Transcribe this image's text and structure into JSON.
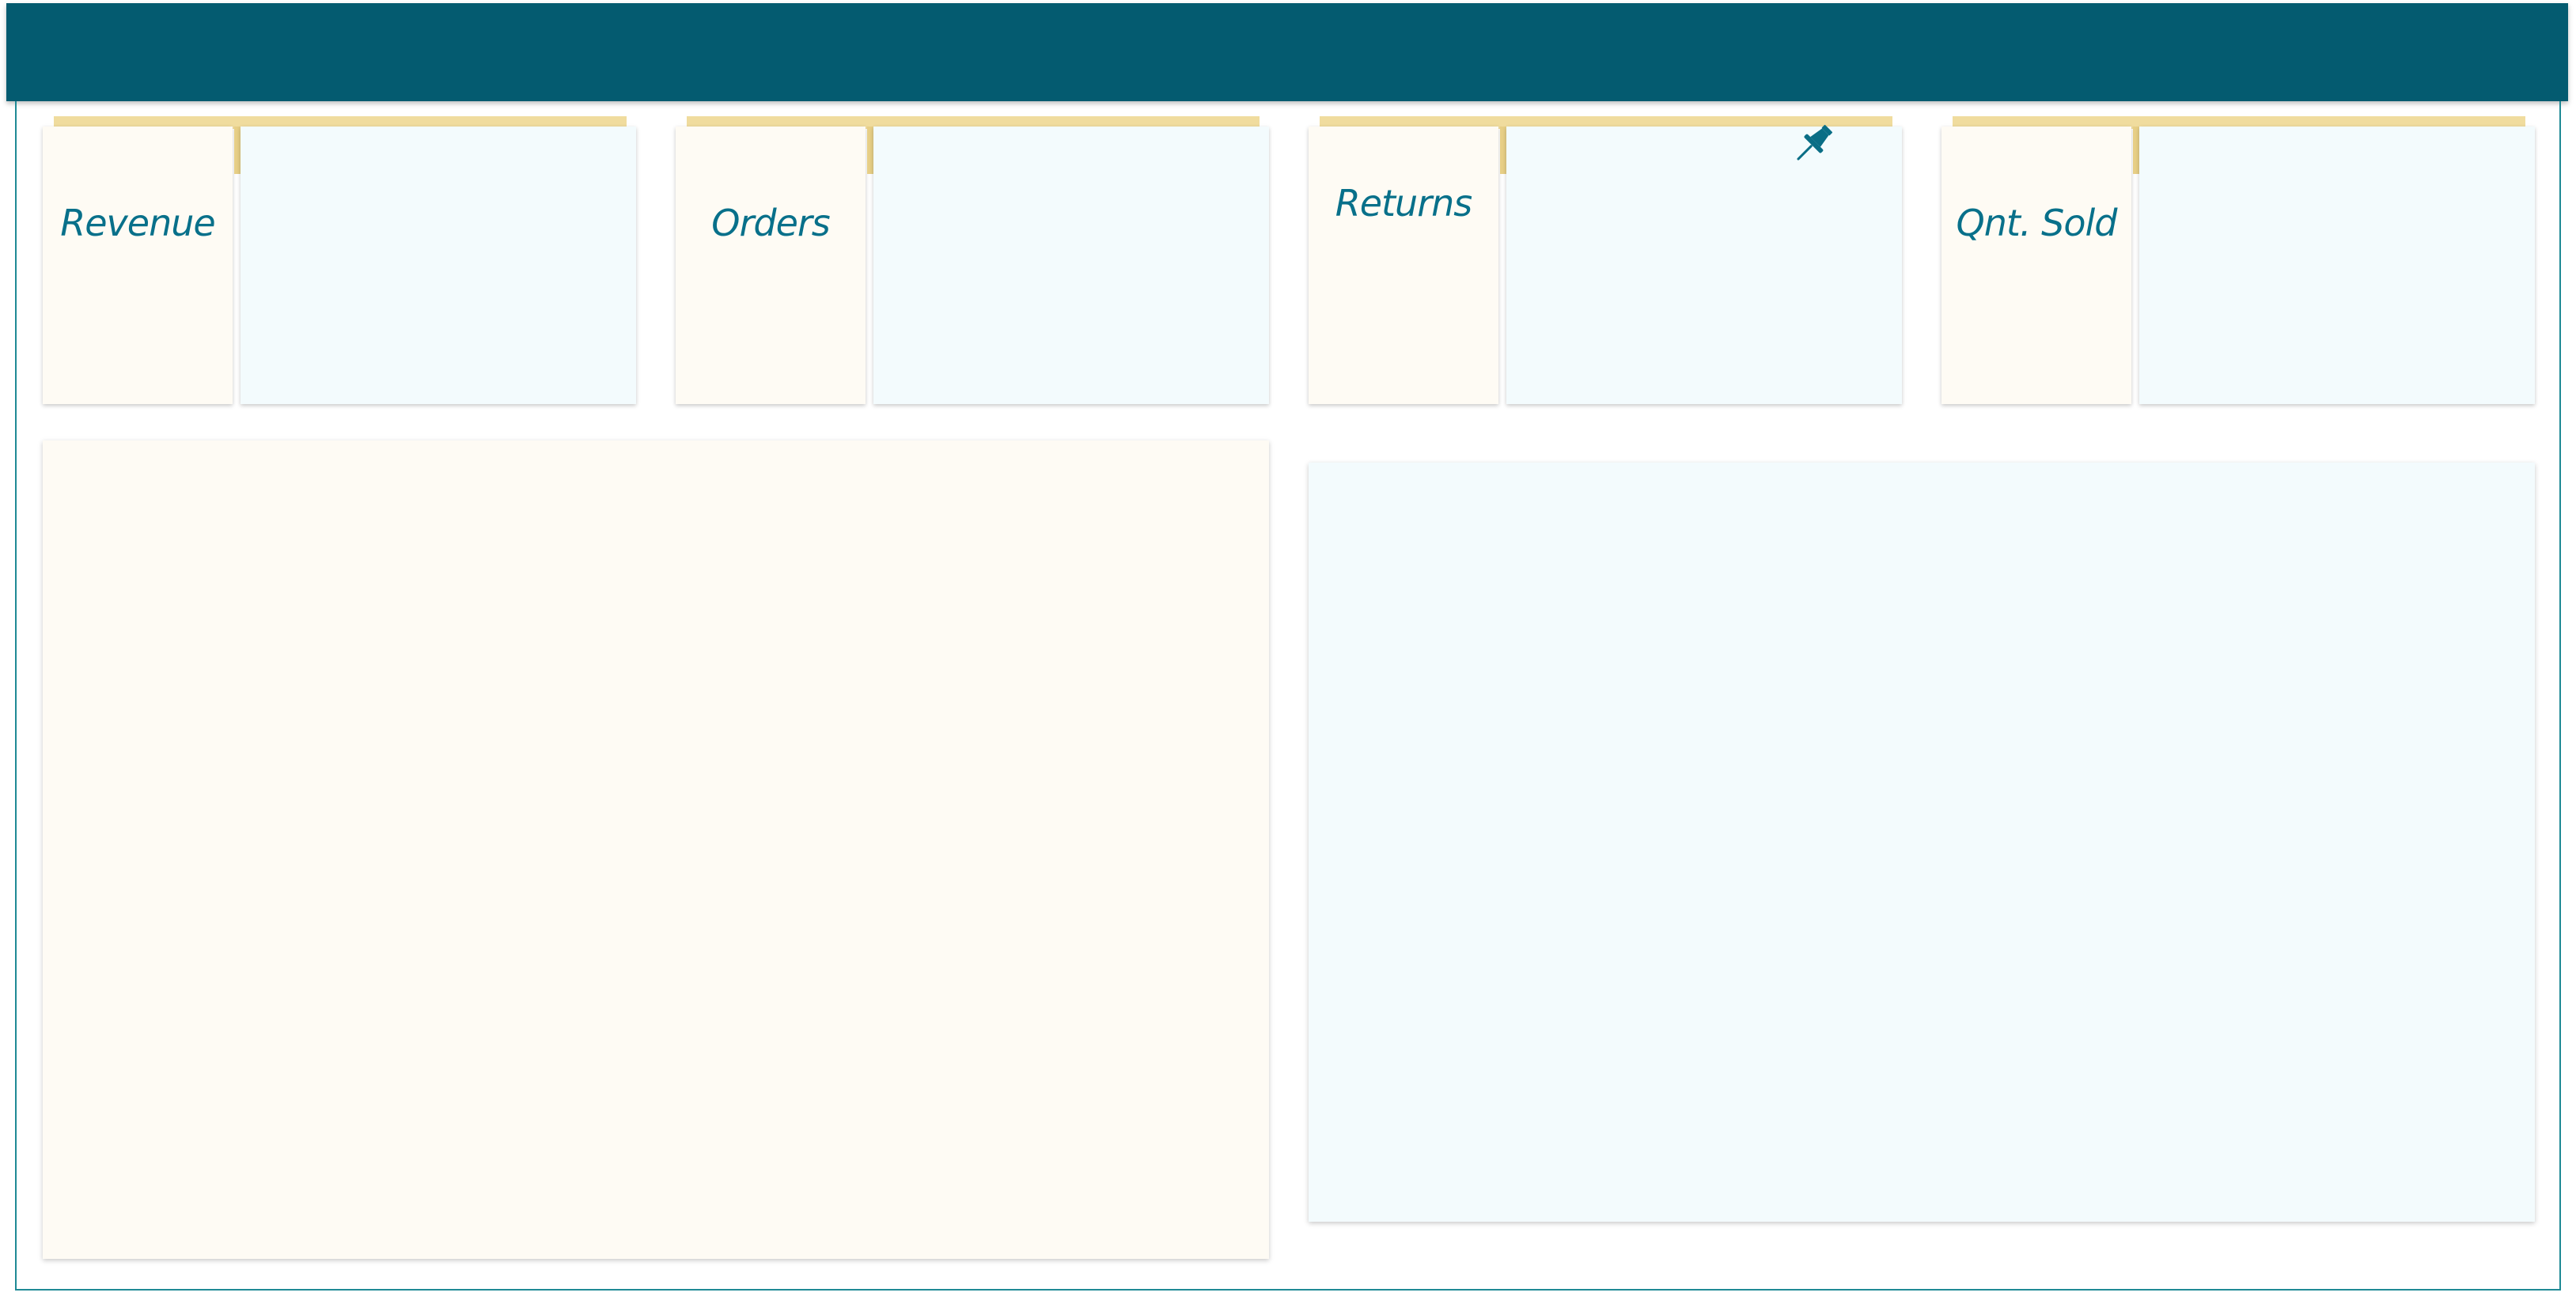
{
  "header": {
    "color": "#045b70"
  },
  "kpis": [
    {
      "label": "Revenue"
    },
    {
      "label": "Orders"
    },
    {
      "label": "Returns",
      "pinned": true,
      "pin_icon": "pushpin-icon"
    },
    {
      "label": "Qnt. Sold"
    }
  ],
  "colors": {
    "accent": "#08708a",
    "tape": "#f0dc9e",
    "warm_panel": "#fefbf4",
    "cool_panel": "#f3fbfd",
    "frame": "#1f8a95"
  }
}
